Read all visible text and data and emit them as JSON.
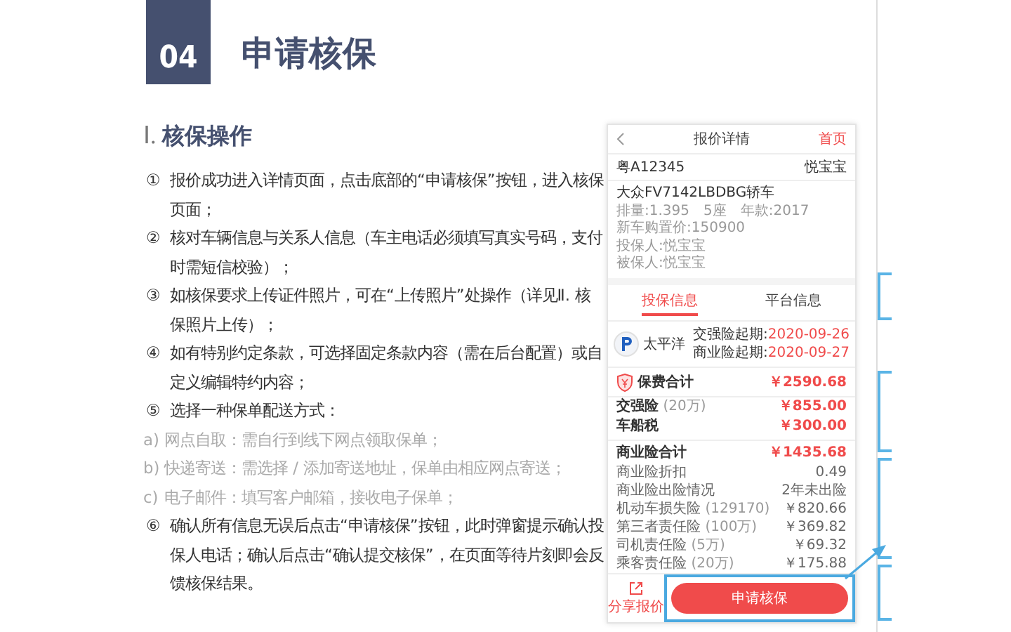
{
  "header": {
    "number": "04",
    "title": "申请核保"
  },
  "section": {
    "numeral": "Ⅰ.",
    "title": "核保操作"
  },
  "steps": [
    {
      "kind": "step",
      "marker": "①",
      "text": "报价成功进入详情页面，点击底部的“申请核保”按钮，进入核保页面；"
    },
    {
      "kind": "step",
      "marker": "②",
      "text": "核对车辆信息与关系人信息（车主电话必须填写真实号码，支付时需短信校验）；"
    },
    {
      "kind": "step",
      "marker": "③",
      "text": "如核保要求上传证件照片，可在“上传照片”处操作（详见Ⅱ. 核保照片上传）；"
    },
    {
      "kind": "step",
      "marker": "④",
      "text": "如有特别约定条款，可选择固定条款内容（需在后台配置）或自定义编辑特约内容；"
    },
    {
      "kind": "step",
      "marker": "⑤",
      "text": "选择一种保单配送方式："
    },
    {
      "kind": "sub",
      "marker": "a)",
      "text": "网点自取：需自行到线下网点领取保单；"
    },
    {
      "kind": "sub",
      "marker": "b)",
      "text": "快递寄送：需选择 / 添加寄送地址，保单由相应网点寄送；"
    },
    {
      "kind": "sub",
      "marker": "c)",
      "text": "电子邮件：填写客户邮箱，接收电子保单；"
    },
    {
      "kind": "step",
      "marker": "⑥",
      "text": "确认所有信息无误后点击“申请核保”按钮，此时弹窗提示确认投保人电话；确认后点击“确认提交核保”，在页面等待片刻即会反馈核保结果。"
    }
  ],
  "phone": {
    "title": "报价详情",
    "home_link": "首页",
    "plate": "粤A12345",
    "owner": "悦宝宝",
    "car_model": "大众FV7142LBDBG轿车",
    "specs": [
      "排量:1.395",
      "5座",
      "年款:2017"
    ],
    "info_lines": [
      "新车购置价:150900",
      "投保人:悦宝宝",
      "被保人:悦宝宝"
    ],
    "tabs": [
      {
        "label": "投保信息",
        "selected": true
      },
      {
        "label": "平台信息",
        "selected": false
      }
    ],
    "insurer": "太平洋",
    "start_dates": [
      {
        "label": "交强险起期:",
        "date": "2020-09-26"
      },
      {
        "label": "商业险起期:",
        "date": "2020-09-27"
      }
    ],
    "total": {
      "label": "保费合计",
      "amount": "￥2590.68"
    },
    "items": [
      {
        "kind": "main",
        "label": "交强险",
        "note": "(20万)",
        "value": "￥855.00"
      },
      {
        "kind": "main",
        "label": "车船税",
        "value": "￥300.00"
      },
      {
        "kind": "subtotal",
        "label": "商业险合计",
        "value": "￥1435.68"
      },
      {
        "kind": "detail",
        "label": "商业险折扣",
        "value": "0.49"
      },
      {
        "kind": "detail",
        "label": "商业险出险情况",
        "value": "2年未出险"
      },
      {
        "kind": "detail",
        "label": "机动车损失险",
        "note": "(129170)",
        "value": "￥820.66"
      },
      {
        "kind": "detail",
        "label": "第三者责任险",
        "note": "(100万)",
        "value": "￥369.82"
      },
      {
        "kind": "detail",
        "label": "司机责任险",
        "note": "(5万)",
        "value": "￥69.32"
      },
      {
        "kind": "detail",
        "label": "乘客责任险",
        "note": "(20万)",
        "value": "￥175.88"
      }
    ],
    "share": "分享报价",
    "submit": "申请核保"
  }
}
